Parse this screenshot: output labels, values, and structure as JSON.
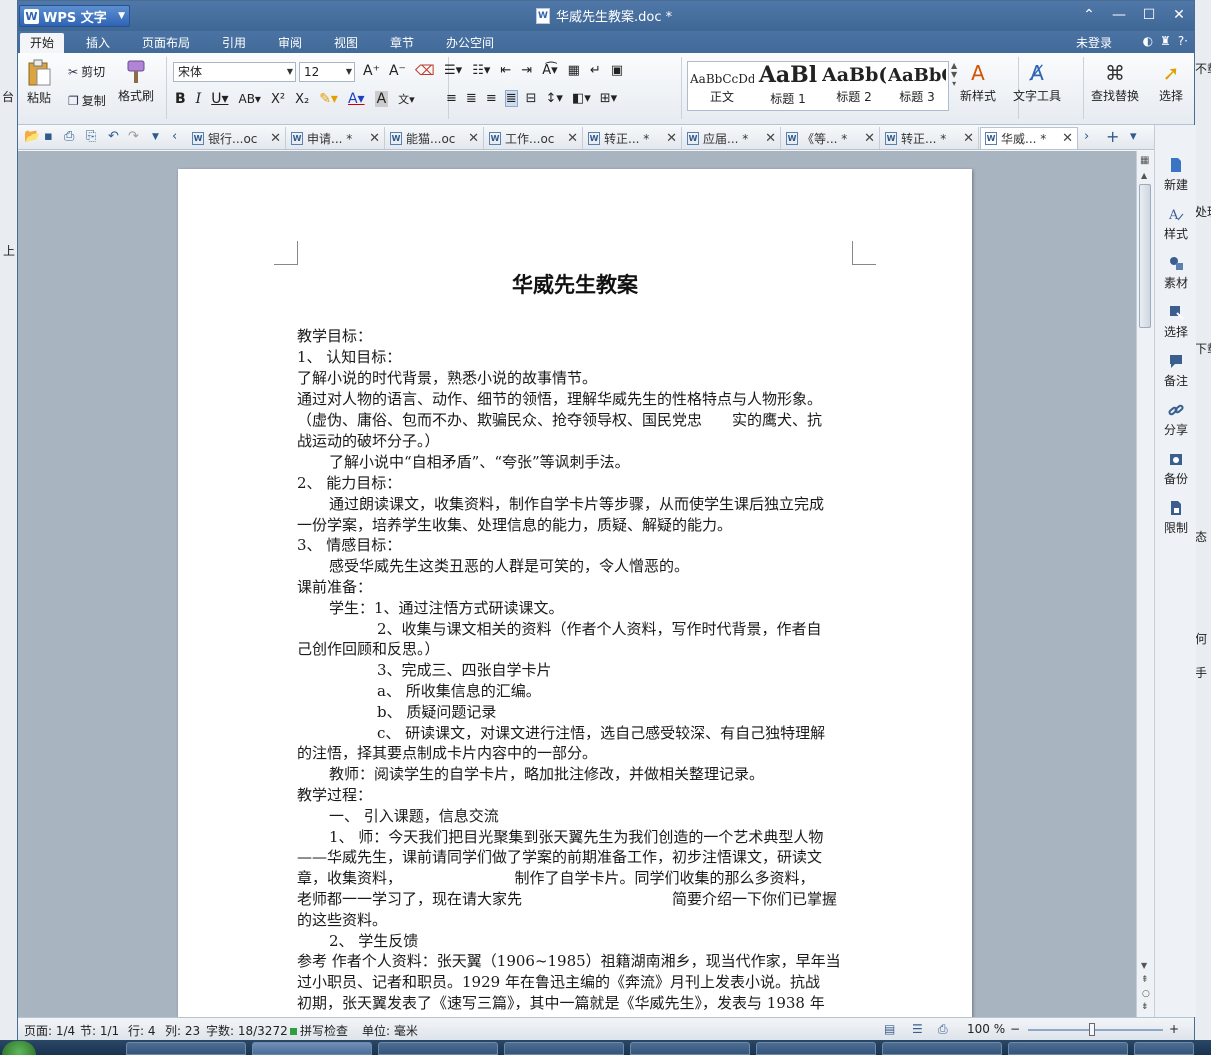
{
  "app": {
    "name": "WPS 文字",
    "doc_title": "华威先生教案.doc *"
  },
  "menu_tabs": [
    "开始",
    "插入",
    "页面布局",
    "引用",
    "审阅",
    "视图",
    "章节",
    "办公空间"
  ],
  "account": {
    "login_label": "未登录"
  },
  "ribbon": {
    "paste_label": "粘贴",
    "cut_label": "剪切",
    "copy_label": "复制",
    "format_painter_label": "格式刷",
    "font_name": "宋体",
    "font_size": "12",
    "styles": [
      {
        "sample": "AaBbCcDd",
        "label": "正文"
      },
      {
        "sample": "AaBl",
        "label": "标题 1"
      },
      {
        "sample": "AaBb(",
        "label": "标题 2"
      },
      {
        "sample": "AaBbC",
        "label": "标题 3"
      }
    ],
    "new_style_label": "新样式",
    "text_tools_label": "文字工具",
    "find_replace_label": "查找替换",
    "select_label": "选择"
  },
  "doc_tabs": [
    {
      "label": "银行...oc",
      "active": false
    },
    {
      "label": "申请... *",
      "active": false
    },
    {
      "label": "能猫...oc",
      "active": false
    },
    {
      "label": "工作...oc",
      "active": false
    },
    {
      "label": "转正... *",
      "active": false
    },
    {
      "label": "应届... *",
      "active": false
    },
    {
      "label": "《等... *",
      "active": false
    },
    {
      "label": "转正... *",
      "active": false
    },
    {
      "label": "华威... *",
      "active": true
    }
  ],
  "sidebar": [
    "新建",
    "样式",
    "素材",
    "选择",
    "备注",
    "分享",
    "备份",
    "限制"
  ],
  "document": {
    "title": "华威先生教案",
    "lines": [
      "教学目标：",
      "1、  认知目标：",
      "了解小说的时代背景，熟悉小说的故事情节。",
      "通过对人物的语言、动作、细节的领悟，理解华威先生的性格特点与人物形象。",
      "（虚伪、庸俗、包而不办、欺骗民众、抢夺领导权、国民党忠　　实的鹰犬、抗",
      "战运动的破坏分子。）",
      "了解小说中“自相矛盾”、“夸张”等讽刺手法。",
      "2、  能力目标：",
      "通过朗读课文，收集资料，制作自学卡片等步骤，从而使学生课后独立完成",
      "一份学案，培养学生收集、处理信息的能力，质疑、解疑的能力。",
      "3、  情感目标：",
      "感受华威先生这类丑恶的人群是可笑的，令人憎恶的。",
      "课前准备：",
      "学生：1、通过注悟方式研读课文。",
      "2、收集与课文相关的资料（作者个人资料，写作时代背景，作者自",
      "己创作回顾和反思。）",
      "3、完成三、四张自学卡片",
      "a、  所收集信息的汇编。",
      "b、  质疑问题记录",
      "c、  研读课文，对课文进行注悟，选自己感受较深、有自己独特理解",
      "的注悟，择其要点制成卡片内容中的一部分。",
      "教师：阅读学生的自学卡片，略加批注修改，并做相关整理记录。",
      "教学过程：",
      "一、  引入课题，信息交流",
      "1、  师：今天我们把目光聚集到张天翼先生为我们创造的一个艺术典型人物",
      "——华威先生，课前请同学们做了学案的前期准备工作，初步注悟课文，研读文",
      "章，收集资料，　　　　　　　　制作了自学卡片。同学们收集的那么多资料，",
      "老师都一一学习了，现在请大家先　　　　　　　　　　简要介绍一下你们已掌握",
      "的这些资料。",
      "2、  学生反馈",
      "参考  作者个人资料：张天翼（1906~1985）祖籍湖南湘乡，现当代作家，早年当",
      "过小职员、记者和职员。1929 年在鲁迅主编的《奔流》月刊上发表小说。抗战",
      "初期，张天翼发表了《速写三篇》，其中一篇就是《华威先生》，发表与 1938 年"
    ]
  },
  "status": {
    "page": "页面: 1/4",
    "section": "节: 1/1",
    "row": "行: 4",
    "col": "列: 23",
    "words": "字数: 18/3272",
    "spell": "拼写检查",
    "unit": "单位: 毫米",
    "zoom": "100 %",
    "zoom_fraction": 0.47
  },
  "background_fragments": [
    "台",
    "上",
    "不载",
    "处理",
    "下载",
    "态",
    "何",
    "手"
  ]
}
